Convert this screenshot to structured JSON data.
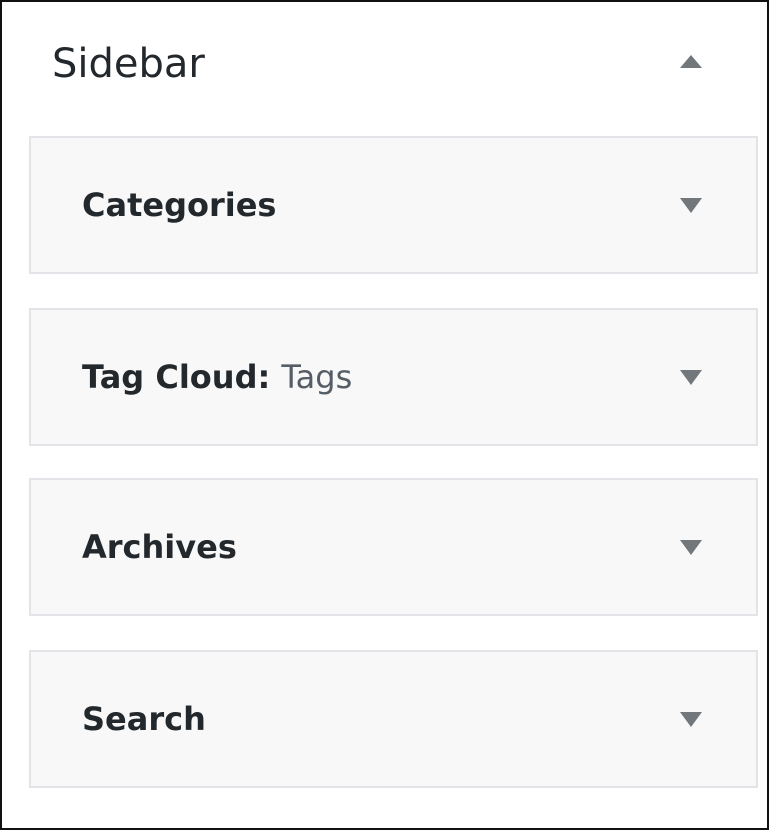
{
  "panel": {
    "title": "Sidebar",
    "toggle_icon": "triangle-up-icon"
  },
  "widgets": [
    {
      "title": "Categories",
      "subtitle": "",
      "icon": "triangle-down-icon"
    },
    {
      "title": "Tag Cloud:",
      "subtitle": "Tags",
      "icon": "triangle-down-icon"
    },
    {
      "title": "Archives",
      "subtitle": "",
      "icon": "triangle-down-icon"
    },
    {
      "title": "Search",
      "subtitle": "",
      "icon": "triangle-down-icon"
    }
  ],
  "colors": {
    "text": "#23282d",
    "subtext": "#555d66",
    "arrow": "#72777c",
    "widget_bg": "#f8f8f8",
    "widget_border": "#e2e4e7",
    "panel_border": "#111111"
  }
}
